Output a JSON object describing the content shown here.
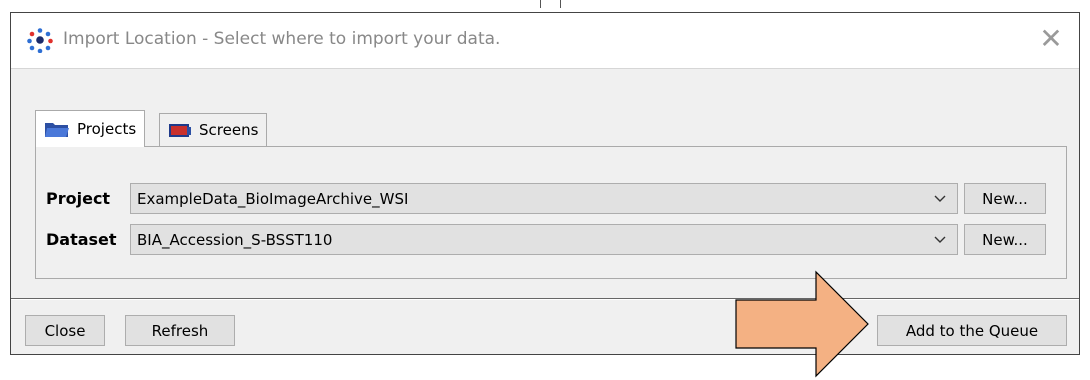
{
  "window": {
    "title": "Import Location - Select where to import your data."
  },
  "tabs": [
    {
      "label": "Projects",
      "icon": "folder-icon",
      "active": true
    },
    {
      "label": "Screens",
      "icon": "screen-plate-icon",
      "active": false
    }
  ],
  "form": {
    "project_label": "Project",
    "project_value": "ExampleData_BioImageArchive_WSI",
    "dataset_label": "Dataset",
    "dataset_value": "BIA_Accession_S-BSST110",
    "new_label": "New..."
  },
  "footer": {
    "close_label": "Close",
    "refresh_label": "Refresh",
    "add_queue_label": "Add to the Queue"
  },
  "colors": {
    "arrow_fill": "#f4b183",
    "arrow_stroke": "#000000"
  }
}
